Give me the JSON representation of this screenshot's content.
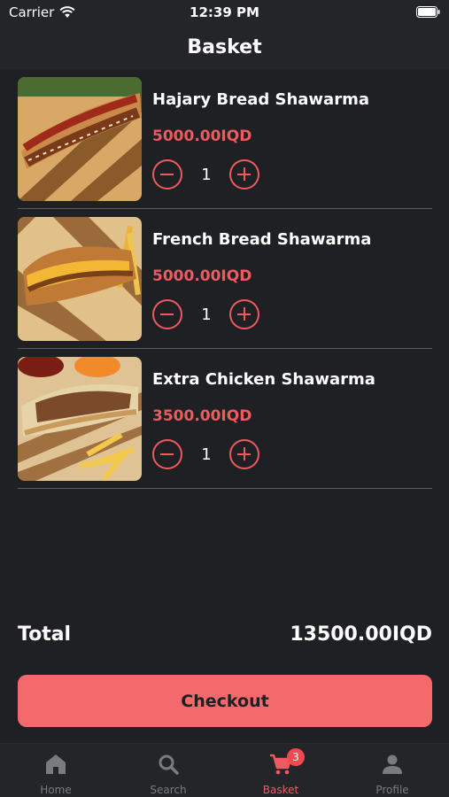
{
  "status_bar": {
    "carrier": "Carrier",
    "time": "12:39 PM"
  },
  "header": {
    "title": "Basket"
  },
  "items": [
    {
      "name": "Hajary Bread Shawarma",
      "price": "5000.00IQD",
      "quantity": "1"
    },
    {
      "name": "French Bread Shawarma",
      "price": "5000.00IQD",
      "quantity": "1"
    },
    {
      "name": "Extra Chicken Shawarma",
      "price": "3500.00IQD",
      "quantity": "1"
    }
  ],
  "summary": {
    "total_label": "Total",
    "total_value": "13500.00IQD"
  },
  "checkout": {
    "label": "Checkout"
  },
  "tab_bar": {
    "tabs": [
      {
        "label": "Home",
        "icon": "home-icon"
      },
      {
        "label": "Search",
        "icon": "search-icon"
      },
      {
        "label": "Basket",
        "icon": "cart-icon",
        "badge": "3"
      },
      {
        "label": "Profile",
        "icon": "person-icon"
      }
    ],
    "active_index": 2
  },
  "colors": {
    "accent": "#ee5a5f",
    "checkout_button": "#f46a6c",
    "background": "#1f2023",
    "inactive_tab": "#7a7b7f"
  }
}
